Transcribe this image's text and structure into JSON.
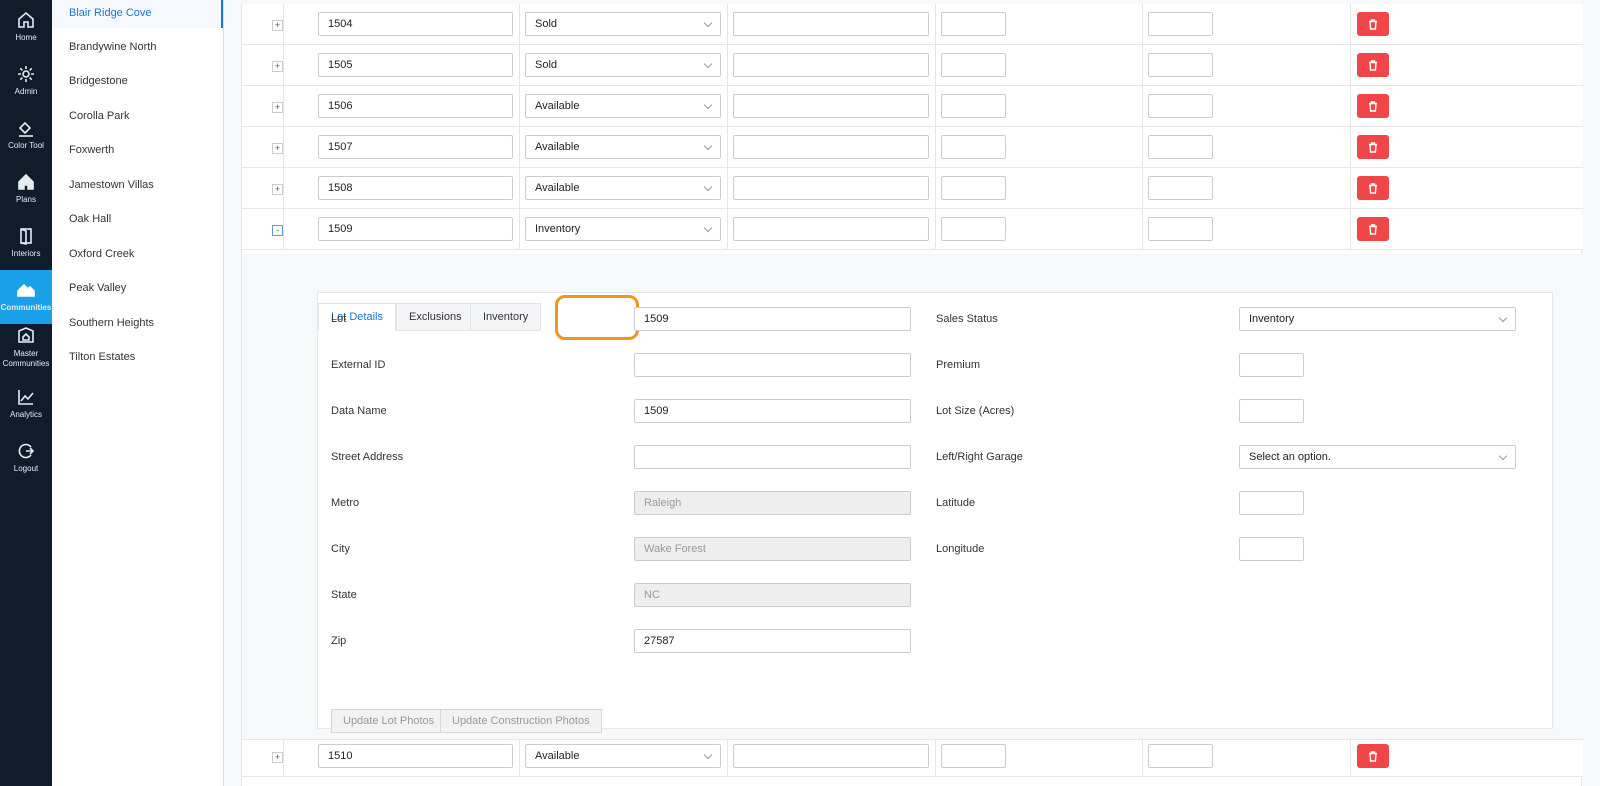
{
  "nav": [
    {
      "label": "Home",
      "icon": "home-outline-icon"
    },
    {
      "label": "Admin",
      "icon": "gear-icon"
    },
    {
      "label": "Color Tool",
      "icon": "paint-bucket-icon"
    },
    {
      "label": "Plans",
      "icon": "house-icon"
    },
    {
      "label": "Interiors",
      "icon": "door-icon"
    },
    {
      "label": "Communities",
      "icon": "houses-icon",
      "active": true
    },
    {
      "label": "Master Communities",
      "icon": "badge-house-icon"
    },
    {
      "label": "Analytics",
      "icon": "line-chart-icon"
    },
    {
      "label": "Logout",
      "icon": "logout-icon"
    }
  ],
  "communities": [
    "Blair Ridge Cove",
    "Brandywine North",
    "Bridgestone",
    "Corolla Park",
    "Foxwerth",
    "Jamestown Villas",
    "Oak Hall",
    "Oxford Creek",
    "Peak Valley",
    "Southern Heights",
    "Tilton Estates"
  ],
  "active_community": "Blair Ridge Cove",
  "lots": [
    {
      "lot": "1504",
      "status": "Sold",
      "expander": "+"
    },
    {
      "lot": "1505",
      "status": "Sold",
      "expander": "+"
    },
    {
      "lot": "1506",
      "status": "Available",
      "expander": "+"
    },
    {
      "lot": "1507",
      "status": "Available",
      "expander": "+"
    },
    {
      "lot": "1508",
      "status": "Available",
      "expander": "+"
    },
    {
      "lot": "1509",
      "status": "Inventory",
      "expander": "-"
    }
  ],
  "after_lot": {
    "lot": "1510",
    "status": "Available",
    "expander": "+"
  },
  "detail": {
    "tabs": [
      "Lot Details",
      "Exclusions",
      "Inventory"
    ],
    "left_fields": [
      {
        "label": "Lot",
        "value": "1509",
        "disabled": false
      },
      {
        "label": "External ID",
        "value": "",
        "disabled": false
      },
      {
        "label": "Data Name",
        "value": "1509",
        "disabled": false
      },
      {
        "label": "Street Address",
        "value": "",
        "disabled": false
      },
      {
        "label": "Metro",
        "value": "Raleigh",
        "disabled": true
      },
      {
        "label": "City",
        "value": "Wake Forest",
        "disabled": true
      },
      {
        "label": "State",
        "value": "NC",
        "disabled": true
      },
      {
        "label": "Zip",
        "value": "27587",
        "disabled": false
      }
    ],
    "right_fields": [
      {
        "label": "Sales Status",
        "value": "Inventory",
        "type": "select"
      },
      {
        "label": "Premium",
        "value": "",
        "type": "small"
      },
      {
        "label": "Lot Size (Acres)",
        "value": "",
        "type": "small"
      },
      {
        "label": "Left/Right Garage",
        "value": "Select an option.",
        "type": "select"
      },
      {
        "label": "Latitude",
        "value": "",
        "type": "small"
      },
      {
        "label": "Longitude",
        "value": "",
        "type": "small"
      }
    ],
    "buttons": [
      "Update Lot Photos",
      "Update Construction Photos"
    ]
  },
  "colors": {
    "rail": "#0f1c2c",
    "accent": "#1aa0e8",
    "delete": "#f0464a",
    "highlight": "#f2951f"
  }
}
